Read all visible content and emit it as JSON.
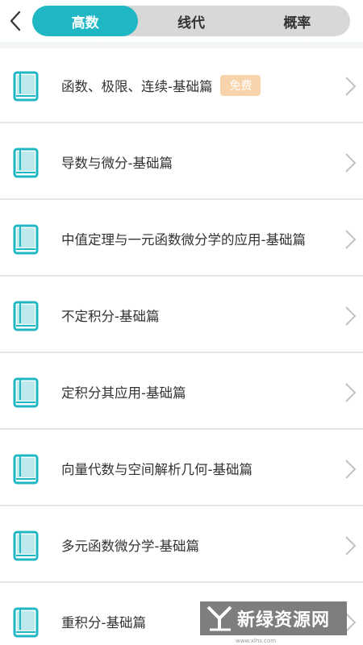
{
  "header": {
    "tabs": [
      {
        "label": "高数",
        "active": true
      },
      {
        "label": "线代",
        "active": false
      },
      {
        "label": "概率",
        "active": false
      }
    ]
  },
  "courses": [
    {
      "title": "函数、极限、连续-基础篇",
      "badge": "免费"
    },
    {
      "title": "导数与微分-基础篇"
    },
    {
      "title": "中值定理与一元函数微分学的应用-基础篇"
    },
    {
      "title": "不定积分-基础篇"
    },
    {
      "title": "定积分其应用-基础篇"
    },
    {
      "title": "向量代数与空间解析几何-基础篇"
    },
    {
      "title": "多元函数微分学-基础篇"
    },
    {
      "title": "重积分-基础篇"
    }
  ],
  "watermark": {
    "text": "新绿资源网",
    "url": "www.xlhs.com"
  },
  "colors": {
    "accent": "#1fb7c4",
    "badge": "#f8d4ac",
    "tab_bg": "#d8d8d8"
  },
  "icons": {
    "back": "chevron-left-icon",
    "row_icon": "book-icon",
    "row_arrow": "chevron-right-icon"
  }
}
